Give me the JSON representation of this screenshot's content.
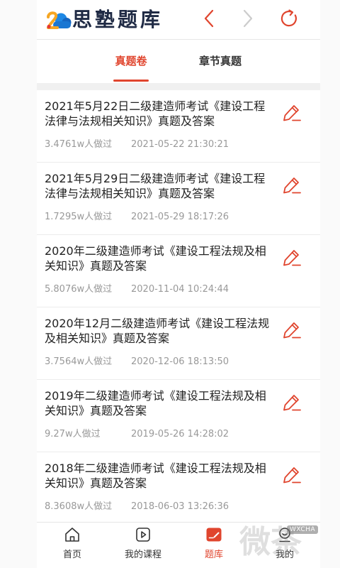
{
  "header": {
    "logo_text": "思塾题库",
    "logo_icon": "cloud-logo-icon",
    "back_icon": "chevron-left-icon",
    "forward_icon": "chevron-right-icon",
    "refresh_icon": "refresh-icon"
  },
  "tabs": [
    {
      "label": "真题卷",
      "active": true
    },
    {
      "label": "章节真题",
      "active": false
    }
  ],
  "papers": [
    {
      "title": "2021年5月22日二级建造师考试《建设工程法律与法规相关知识》真题及答案",
      "attempts": "3.4761w人做过",
      "date": "2021-05-22 21:30:21",
      "action_icon": "edit-pencil-icon"
    },
    {
      "title": "2021年5月29日二级建造师考试《建设工程法律与法规相关知识》真题及答案",
      "attempts": "1.7295w人做过",
      "date": "2021-05-29 18:17:26",
      "action_icon": "edit-pencil-icon"
    },
    {
      "title": "2020年二级建造师考试《建设工程法规及相关知识》真题及答案",
      "attempts": "5.8076w人做过",
      "date": "2020-11-04 10:24:44",
      "action_icon": "edit-pencil-icon"
    },
    {
      "title": "2020年12月二级建造师考试《建设工程法规及相关知识》真题及答案",
      "attempts": "3.7564w人做过",
      "date": "2020-12-06 18:13:50",
      "action_icon": "edit-pencil-icon"
    },
    {
      "title": "2019年二级建造师考试《建设工程法规及相关知识》真题及答案",
      "attempts": "9.27w人做过",
      "date": "2019-05-26 14:28:02",
      "action_icon": "edit-pencil-icon"
    },
    {
      "title": "2018年二级建造师考试《建设工程法规及相关知识》真题及答案",
      "attempts": "8.3608w人做过",
      "date": "2018-06-03 13:26:36",
      "action_icon": "edit-pencil-icon"
    }
  ],
  "bottom_nav": [
    {
      "label": "首页",
      "icon": "home-icon",
      "active": false
    },
    {
      "label": "我的课程",
      "icon": "play-square-icon",
      "active": false
    },
    {
      "label": "题库",
      "icon": "exam-edit-icon",
      "active": true
    },
    {
      "label": "我的",
      "icon": "user-icon",
      "active": false
    }
  ],
  "colors": {
    "accent": "#e0452e",
    "title_text": "#222222",
    "meta_text": "#999999",
    "disabled_arrow": "#cccccc"
  },
  "watermark": {
    "text": "微茶",
    "badge": "WXCHA"
  }
}
